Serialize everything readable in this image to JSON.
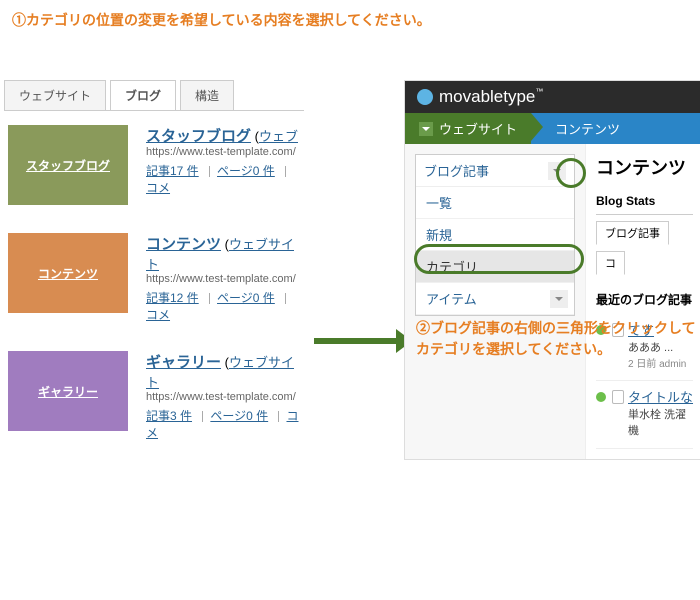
{
  "instructions": {
    "step1": "①カテゴリの位置の変更を希望している内容を選択してください。",
    "step2": "②ブログ記事の右側の三角形をクリックしてカテゴリを選択してください。"
  },
  "left": {
    "tabs": [
      "ウェブサイト",
      "ブログ",
      "構造"
    ],
    "active_tab": 1,
    "blogs": [
      {
        "tile_label": "スタッフブログ",
        "tile_class": "green",
        "title": "スタッフブログ",
        "scope": "ウェブ",
        "url": "https://www.test-template.com/",
        "links": [
          "記事17 件",
          "ページ0 件",
          "コメ"
        ]
      },
      {
        "tile_label": "コンテンツ",
        "tile_class": "orange",
        "title": "コンテンツ",
        "scope": "ウェブサイト",
        "url": "https://www.test-template.com/",
        "links": [
          "記事12 件",
          "ページ0 件",
          "コメ"
        ]
      },
      {
        "tile_label": "ギャラリー",
        "tile_class": "purple",
        "title": "ギャラリー",
        "scope": "ウェブサイト",
        "url": "https://www.test-template.com/",
        "links": [
          "記事3 件",
          "ページ0 件",
          "コメ"
        ]
      }
    ]
  },
  "right": {
    "brand": "movabletype",
    "nav": {
      "website": "ウェブサイト",
      "contents": "コンテンツ"
    },
    "side_menu": {
      "head": "ブログ記事",
      "items": [
        "一覧",
        "新規",
        "カテゴリ",
        "アイテム"
      ],
      "selected": 2
    },
    "main": {
      "title": "コンテンツ",
      "panel": "Blog Stats",
      "ptabs": [
        "ブログ記事",
        "コ"
      ],
      "section": "最近のブログ記事",
      "entries": [
        {
          "title": "てす",
          "body": "あああ ...",
          "meta": "2 日前 admin"
        },
        {
          "title": "タイトルな",
          "body": "単水栓 洗濯機",
          "meta": ""
        }
      ]
    }
  }
}
